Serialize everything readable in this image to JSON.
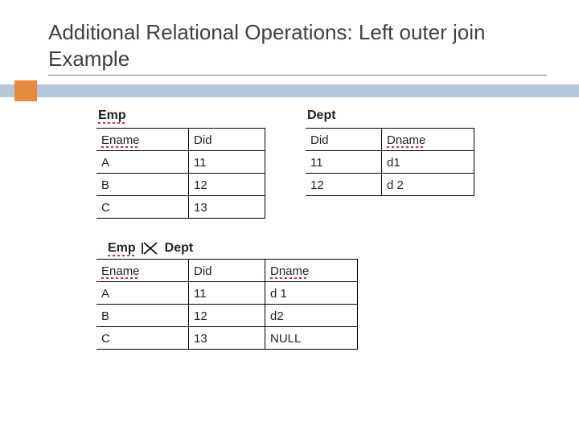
{
  "title": "Additional Relational Operations: Left outer join Example",
  "emp": {
    "name": "Emp",
    "headers": [
      "Ename",
      "Did"
    ],
    "rows": [
      [
        "A",
        "11"
      ],
      [
        "B",
        "12"
      ],
      [
        "C",
        "13"
      ]
    ]
  },
  "dept": {
    "name": "Dept",
    "headers": [
      "Did",
      "Dname"
    ],
    "rows": [
      [
        "11",
        "d1"
      ],
      [
        "12",
        "d 2"
      ]
    ]
  },
  "result": {
    "label_left": "Emp",
    "label_right": "Dept",
    "join_symbol_name": "left-outer-join-icon",
    "headers": [
      "Ename",
      "Did",
      "Dname"
    ],
    "rows": [
      [
        "A",
        "11",
        "d 1"
      ],
      [
        "B",
        "12",
        "d2"
      ],
      [
        "C",
        "13",
        "NULL"
      ]
    ]
  }
}
